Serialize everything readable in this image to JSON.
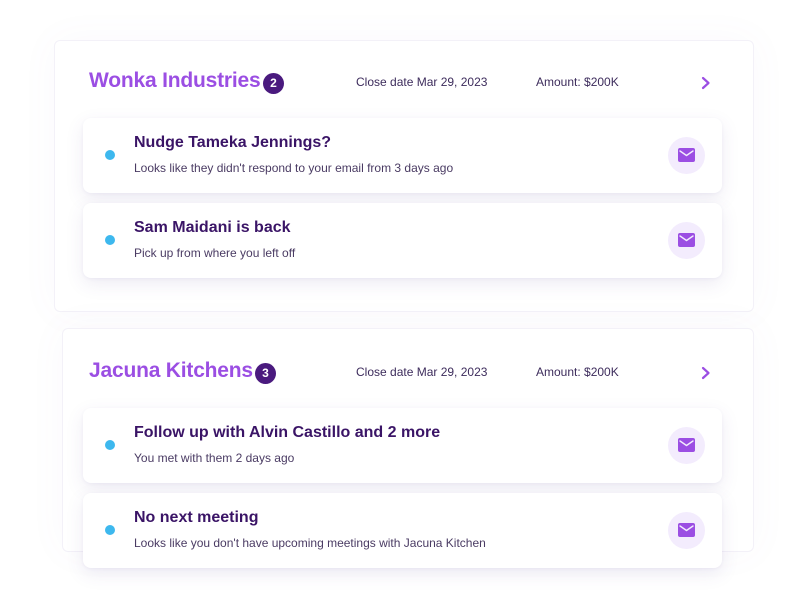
{
  "colors": {
    "accent": "#9b4ee3",
    "badge": "#4a1a7e",
    "dot": "#3db8ee",
    "title": "#3a1466",
    "mail_bg": "#f3ecfd",
    "mail_icon": "#9b4ee3"
  },
  "deals": [
    {
      "company": "Wonka Industries",
      "count": "2",
      "close_date": "Close date Mar 29, 2023",
      "amount": "Amount: $200K",
      "chevron_icon": "chevron-right-icon",
      "tasks": [
        {
          "title": "Nudge Tameka Jennings?",
          "subtitle": "Looks like they didn't respond to your email from 3 days ago",
          "icon": "mail-icon"
        },
        {
          "title": "Sam Maidani is back",
          "subtitle": "Pick up from where you left off",
          "icon": "mail-icon"
        }
      ]
    },
    {
      "company": "Jacuna Kitchens",
      "count": "3",
      "close_date": "Close date Mar 29, 2023",
      "amount": "Amount: $200K",
      "chevron_icon": "chevron-right-icon",
      "tasks": [
        {
          "title": "Follow up with Alvin Castillo and 2 more",
          "subtitle": "You met with them 2 days ago",
          "icon": "mail-icon"
        },
        {
          "title": "No next meeting",
          "subtitle": "Looks like you don't have upcoming meetings with Jacuna Kitchen",
          "icon": "mail-icon"
        }
      ]
    }
  ]
}
